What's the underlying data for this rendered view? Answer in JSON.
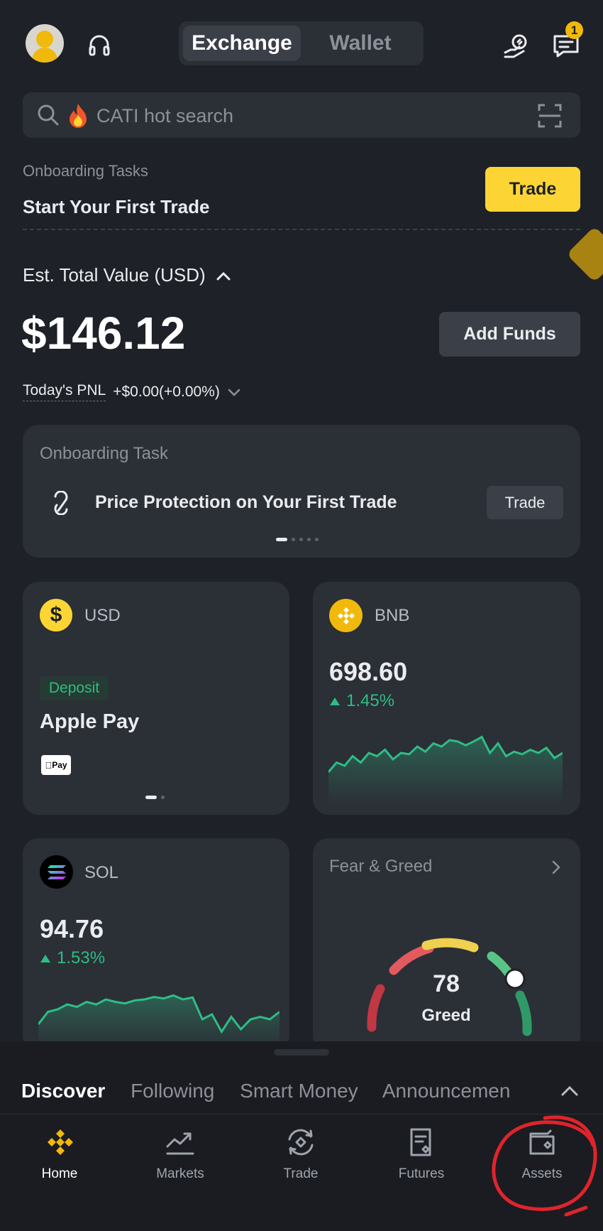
{
  "header": {
    "tabs": [
      {
        "label": "Exchange",
        "active": true
      },
      {
        "label": "Wallet",
        "active": false
      }
    ],
    "notification_count": "1",
    "icons": [
      "avatar",
      "headset-icon",
      "referral-icon",
      "messages-icon"
    ]
  },
  "search": {
    "placeholder": "CATI hot search"
  },
  "onboarding": {
    "label": "Onboarding Tasks",
    "title": "Start Your First Trade",
    "button": "Trade"
  },
  "balance": {
    "label": "Est. Total Value (USD)",
    "value": "$146.12",
    "add_funds": "Add Funds",
    "pnl_label": "Today's PNL",
    "pnl_value": "+$0.00(+0.00%)"
  },
  "task_card": {
    "title": "Onboarding Task",
    "text": "Price Protection on Your First Trade",
    "button": "Trade",
    "pages": 5,
    "active_page": 1
  },
  "usd_card": {
    "symbol": "USD",
    "tag": "Deposit",
    "title": "Apple Pay",
    "badge": "Pay",
    "pages": 2,
    "active_page": 1
  },
  "bnb_card": {
    "symbol": "BNB",
    "price": "698.60",
    "change": "1.45%",
    "trend": [
      0.3,
      0.45,
      0.4,
      0.55,
      0.45,
      0.6,
      0.55,
      0.65,
      0.5,
      0.6,
      0.58,
      0.7,
      0.62,
      0.75,
      0.7,
      0.8,
      0.78,
      0.72,
      0.78,
      0.85,
      0.6,
      0.75,
      0.55,
      0.62,
      0.58,
      0.65,
      0.6,
      0.68,
      0.52,
      0.6
    ]
  },
  "sol_card": {
    "symbol": "SOL",
    "price": "94.76",
    "change": "1.53%",
    "trend": [
      0.2,
      0.45,
      0.5,
      0.6,
      0.55,
      0.65,
      0.6,
      0.7,
      0.65,
      0.62,
      0.68,
      0.7,
      0.75,
      0.72,
      0.78,
      0.7,
      0.74,
      0.3,
      0.4,
      0.05,
      0.35,
      0.1,
      0.3,
      0.35,
      0.3,
      0.45
    ]
  },
  "fear_greed": {
    "title": "Fear & Greed",
    "value": "78",
    "label": "Greed"
  },
  "feed_tabs": [
    "Discover",
    "Following",
    "Smart Money",
    "Announcemen"
  ],
  "nav": [
    {
      "label": "Home",
      "icon": "binance-logo-icon",
      "active": true
    },
    {
      "label": "Markets",
      "icon": "chart-icon",
      "active": false
    },
    {
      "label": "Trade",
      "icon": "trade-icon",
      "active": false
    },
    {
      "label": "Futures",
      "icon": "futures-icon",
      "active": false
    },
    {
      "label": "Assets",
      "icon": "wallet-icon",
      "active": false
    }
  ],
  "colors": {
    "bg": "#1f2128",
    "card": "#2b2f36",
    "accent": "#fcd535",
    "up": "#2ebd85",
    "annotation": "#e0242b"
  }
}
